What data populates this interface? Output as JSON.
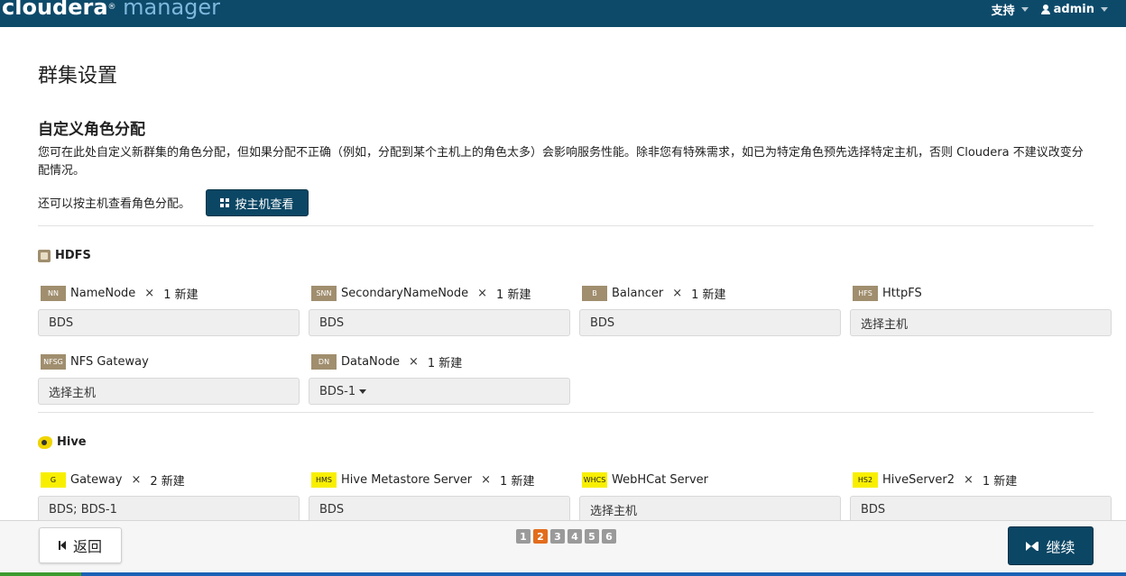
{
  "topbar": {
    "logo_main": "cloudera",
    "logo_sub": "manager",
    "logo_reg": "®",
    "support_label": "支持",
    "user_label": "admin"
  },
  "page": {
    "title": "群集设置",
    "section_title": "自定义角色分配",
    "description": "您可在此处自定义新群集的角色分配，但如果分配不正确（例如，分配到某个主机上的角色太多）会影响服务性能。除非您有特殊需求，如已为特定角色预先选择特定主机，否则 Cloudera 不建议改变分配情况。",
    "hint": "还可以按主机查看角色分配。",
    "view_by_host_label": "按主机查看"
  },
  "hdfs": {
    "name": "HDFS",
    "roles": [
      {
        "badge": "NN",
        "name": "NameNode",
        "times": "×",
        "count": "1 新建",
        "value": "BDS"
      },
      {
        "badge": "SNN",
        "name": "SecondaryNameNode",
        "times": "×",
        "count": "1 新建",
        "value": "BDS"
      },
      {
        "badge": "B",
        "name": "Balancer",
        "times": "×",
        "count": "1 新建",
        "value": "BDS"
      },
      {
        "badge": "HFS",
        "name": "HttpFS",
        "value": "选择主机"
      },
      {
        "badge": "NFSG",
        "name": "NFS Gateway",
        "value": "选择主机"
      },
      {
        "badge": "DN",
        "name": "DataNode",
        "times": "×",
        "count": "1 新建",
        "value": "BDS-1"
      }
    ]
  },
  "hive": {
    "name": "Hive",
    "roles": [
      {
        "badge": "G",
        "name": "Gateway",
        "times": "×",
        "count": "2 新建",
        "value": "BDS; BDS-1"
      },
      {
        "badge": "HMS",
        "name": "Hive Metastore Server",
        "times": "×",
        "count": "1 新建",
        "value": "BDS"
      },
      {
        "badge": "WHCS",
        "name": "WebHCat Server",
        "value": "选择主机"
      },
      {
        "badge": "HS2",
        "name": "HiveServer2",
        "times": "×",
        "count": "1 新建",
        "value": "BDS"
      }
    ]
  },
  "footer": {
    "back_label": "返回",
    "continue_label": "继续",
    "pages": [
      "1",
      "2",
      "3",
      "4",
      "5",
      "6"
    ],
    "active_page": "2"
  },
  "colors": {
    "topbar": "#0d4a6a",
    "primary_button": "#0b4664",
    "hdfs_badge": "#a08e6e",
    "hive_badge": "#f8ef00",
    "active_page": "#e36d1c"
  }
}
